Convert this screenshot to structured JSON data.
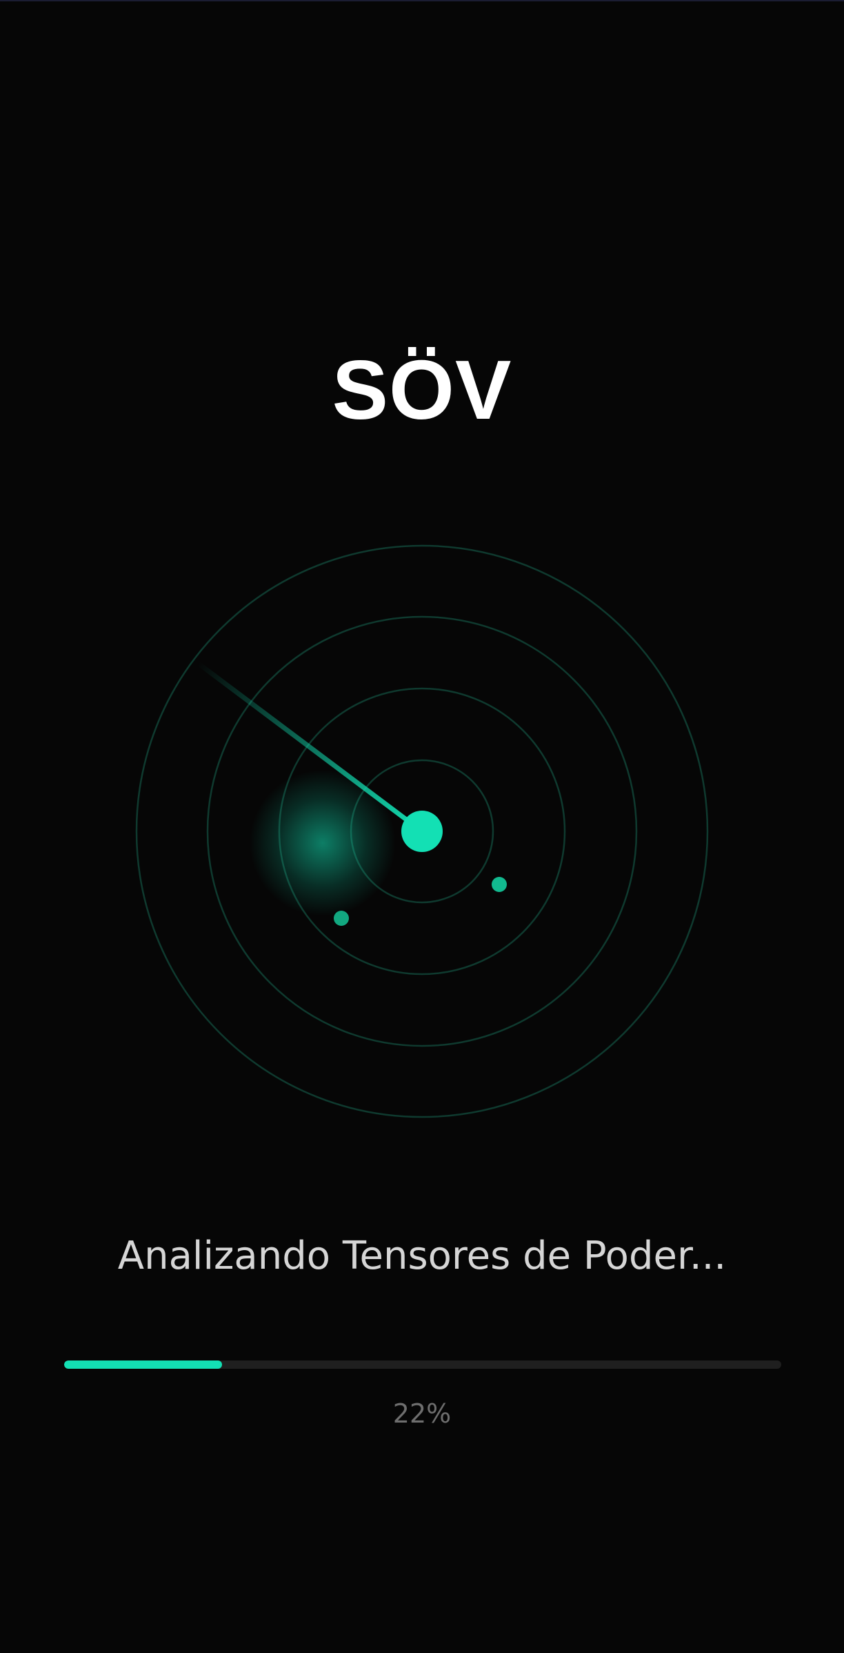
{
  "app": {
    "logo_text": "SÖV"
  },
  "loader": {
    "status_text": "Analizando Tensores de Poder...",
    "progress_fraction": 0.22,
    "progress_label": "22%"
  },
  "radar": {
    "rings": 4,
    "blips": 2,
    "icon": "radar-icon"
  },
  "colors": {
    "background": "#060606",
    "accent": "#13e0b4",
    "ring": "#0f3a2f",
    "track": "#1f1f1f",
    "status_text": "#d6d6d6",
    "percent_text": "#6e6e6e"
  }
}
